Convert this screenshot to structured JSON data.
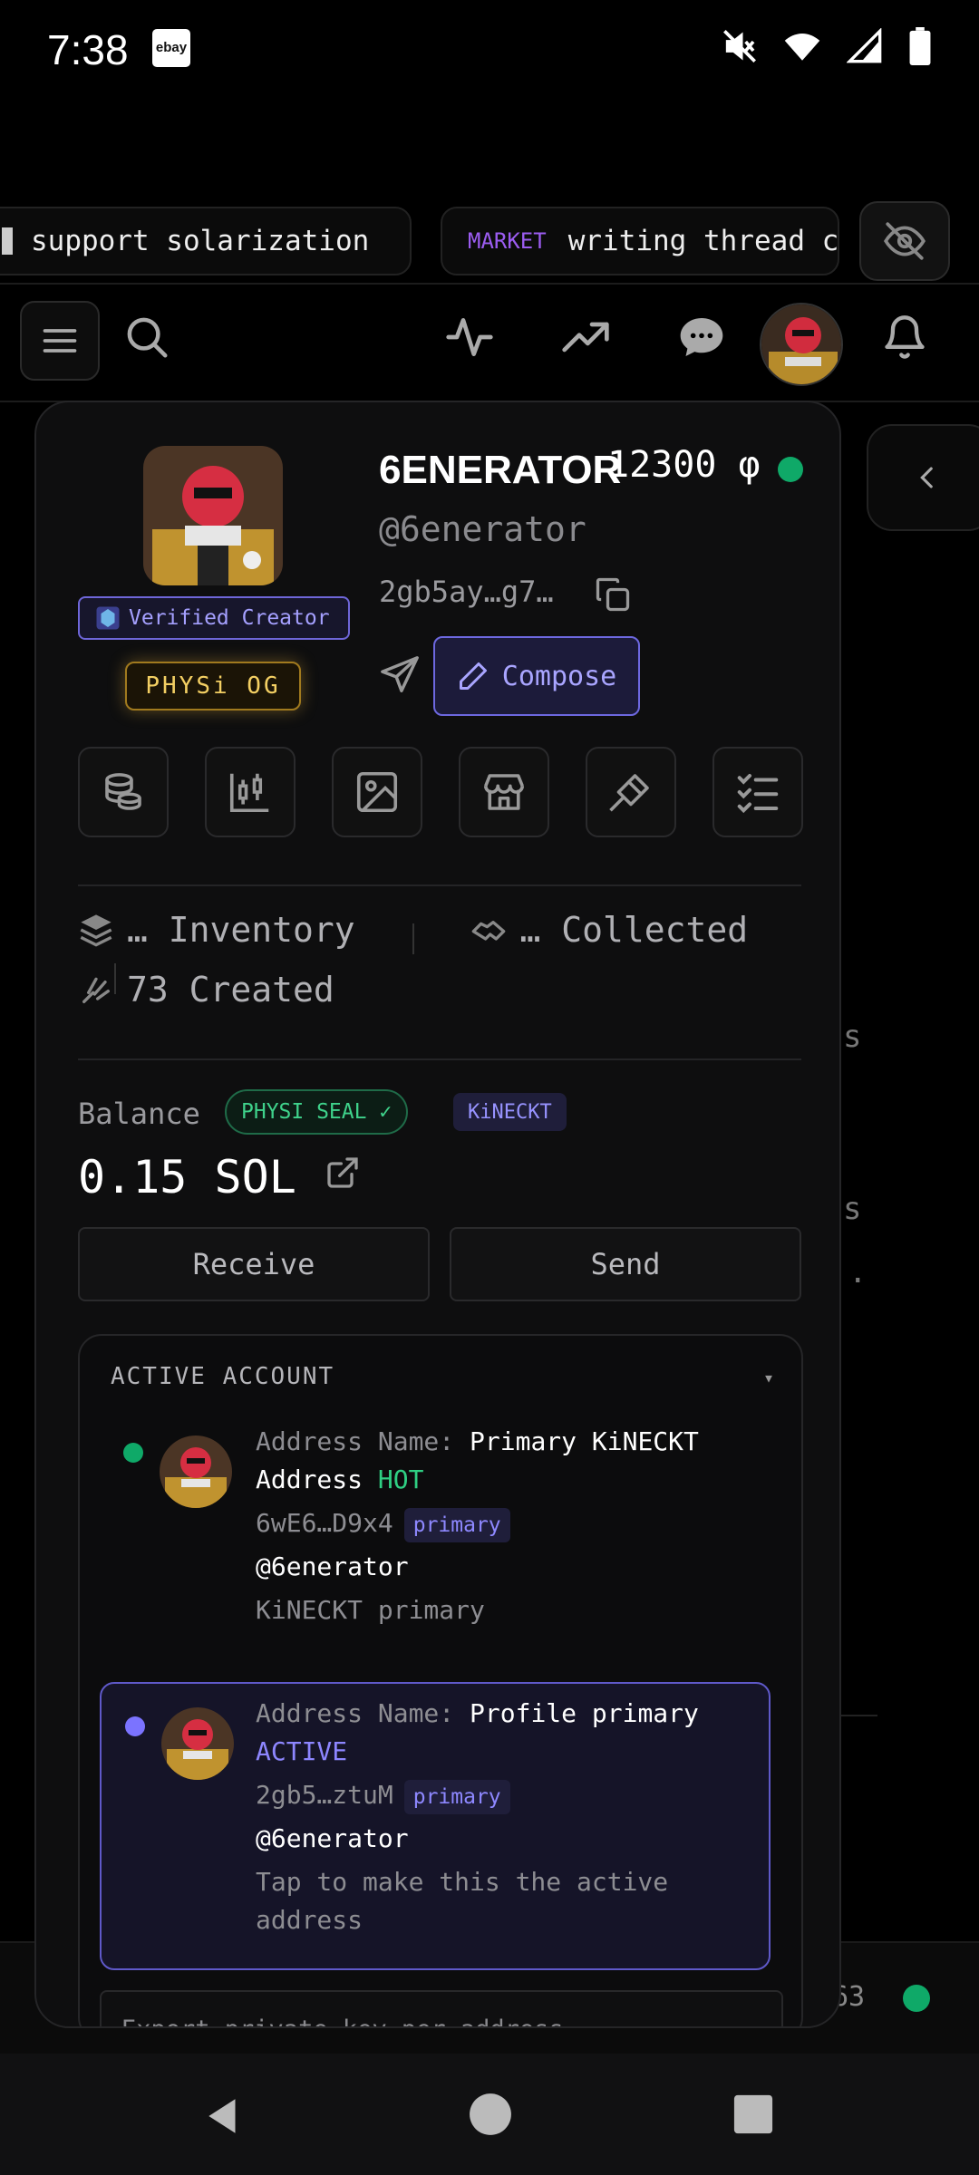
{
  "status_bar": {
    "time": "7:38",
    "notification_app": "ebay",
    "icons": [
      "mute-icon",
      "wifi-icon",
      "signal-icon",
      "battery-icon"
    ]
  },
  "ticker": {
    "items": [
      {
        "tag": "",
        "text": "support solarization"
      },
      {
        "tag": "MARKET",
        "text": "writing thread c"
      }
    ]
  },
  "nav": {
    "icons": [
      "menu-icon",
      "search-icon",
      "activity-icon",
      "trending-icon",
      "chat-icon",
      "profile-avatar",
      "bell-icon"
    ]
  },
  "background": {
    "fragments": [
      "s",
      "s",
      ".",
      "63"
    ]
  },
  "profile": {
    "display_name": "6ENERATOR",
    "points": "12300 φ",
    "handle": "@6enerator",
    "wallet_short": "2gb5ay…g7…",
    "verified_label": "Verified Creator",
    "og_label": "PHYSi OG",
    "compose_label": "Compose"
  },
  "tools": [
    "coins-icon",
    "chart-icon",
    "image-icon",
    "store-icon",
    "gavel-icon",
    "checklist-icon"
  ],
  "stats": {
    "inventory": "… Inventory",
    "collected": "… Collected",
    "created": "73 Created"
  },
  "balance": {
    "label": "Balance",
    "seal": "PHYSI SEAL ✓",
    "network": "KiNECKT",
    "amount": "0.15 SOL",
    "receive_label": "Receive",
    "send_label": "Send"
  },
  "account": {
    "header": "ACTIVE ACCOUNT",
    "caret": "▾",
    "accounts": [
      {
        "name_label": "Address Name:",
        "name": "Primary KiNECKT Address",
        "status": "HOT",
        "address": "6wE6…D9x4",
        "chip": "primary",
        "handle": "@6enerator",
        "note": "KiNECKT primary",
        "dot_color": "#0fa968"
      },
      {
        "name_label": "Address Name:",
        "name": "Profile primary",
        "status": "ACTIVE",
        "address": "2gb5…ztuM",
        "chip": "primary",
        "handle": "@6enerator",
        "note": "Tap to make this the active address",
        "dot_color": "#7b73ff"
      }
    ],
    "export_label": "Export private key per address →"
  },
  "colors": {
    "accent": "#6d68e0",
    "green": "#0fa968",
    "gold": "#f3cf63"
  }
}
